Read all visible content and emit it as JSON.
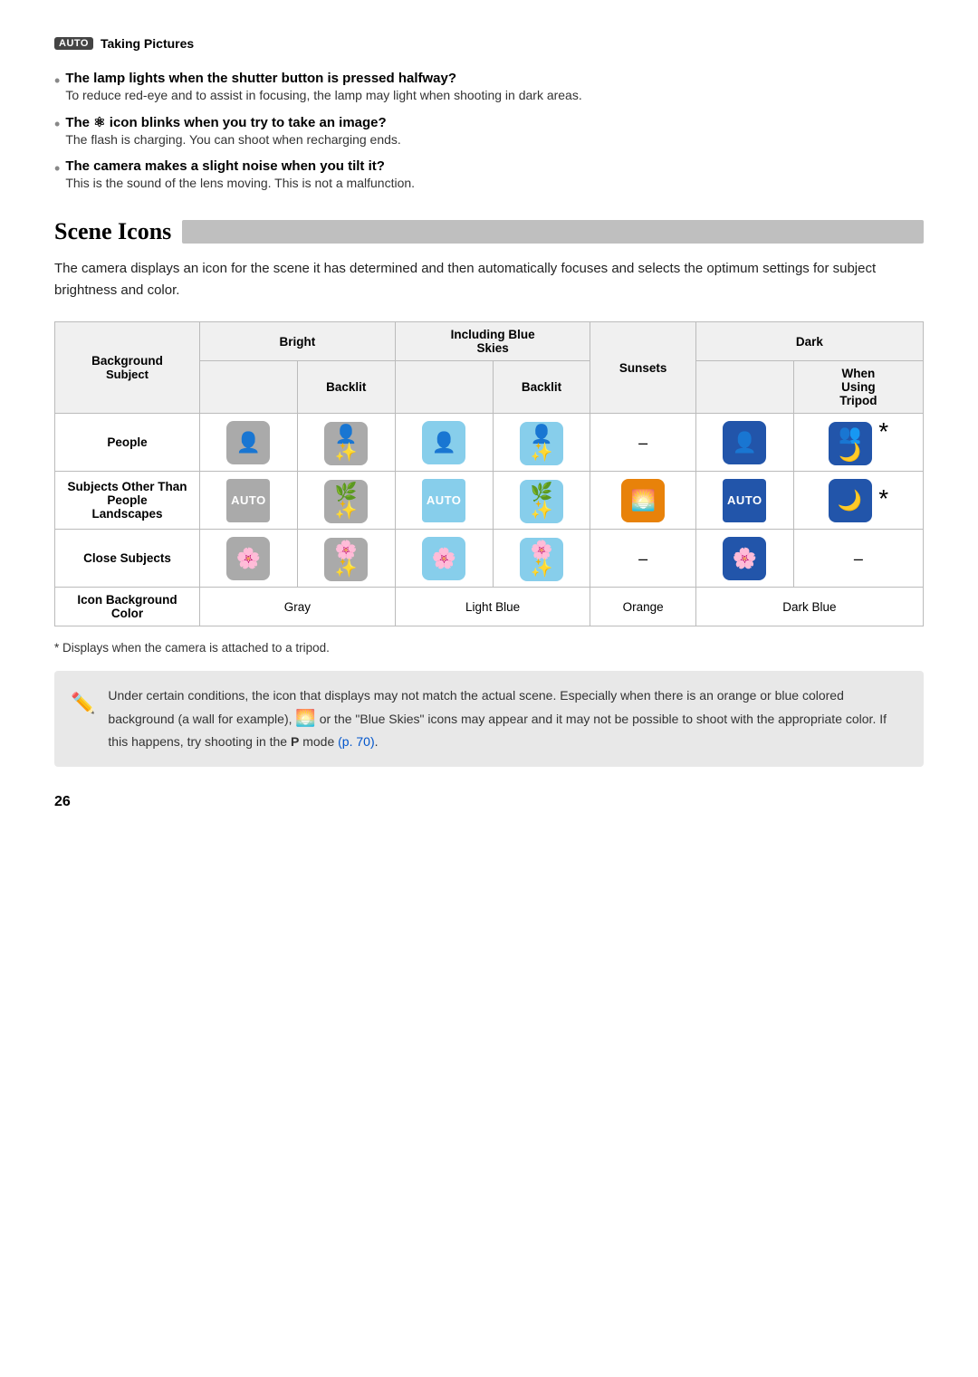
{
  "header": {
    "badge": "AUTO",
    "title": "Taking Pictures"
  },
  "faq": {
    "items": [
      {
        "question": "The lamp lights when the shutter button is pressed halfway?",
        "answer": "To reduce red-eye and to assist in focusing, the lamp may light when shooting in dark areas."
      },
      {
        "question": "The ↯ icon blinks when you try to take an image?",
        "answer": "The flash is charging. You can shoot when recharging ends."
      },
      {
        "question": "The camera makes a slight noise when you tilt it?",
        "answer": "This is the sound of the lens moving. This is not a malfunction."
      }
    ]
  },
  "section": {
    "title": "Scene Icons",
    "description": "The camera displays an icon for the scene it has determined and then automatically focuses and selects the optimum settings for subject brightness and color."
  },
  "table": {
    "col_headers": {
      "background": "Background",
      "subject": "Subject",
      "bright": "Bright",
      "backlit_bright": "Backlit",
      "including_blue_skies": "Including Blue\nSkies",
      "backlit_blue": "Backlit",
      "sunsets": "Sunsets",
      "dark": "Dark",
      "when_using_tripod": "When\nUsing\nTripod"
    },
    "rows": [
      {
        "label": "People",
        "icons": [
          "👤",
          "👤🔅",
          "👤",
          "👤🔅",
          "–",
          "👤",
          "👤🌙*"
        ]
      },
      {
        "label": "Subjects Other Than People\nLandscapes",
        "icons": [
          "AUTO",
          "🌿🔅",
          "AUTO",
          "🌿🔅",
          "🌅",
          "AUTO",
          "🌙*"
        ]
      },
      {
        "label": "Close Subjects",
        "icons": [
          "🌸",
          "🌸🔅",
          "🌸",
          "🌸🔅",
          "–",
          "🌸",
          "–"
        ]
      },
      {
        "label": "Icon Background\nColor",
        "icons": [
          "Gray",
          "Gray",
          "Light Blue",
          "Light Blue",
          "Orange",
          "Dark Blue",
          "Dark Blue"
        ]
      }
    ]
  },
  "footnote": "*  Displays when the camera is attached to a tripod.",
  "note": {
    "text": "Under certain conditions, the icon that displays may not match the actual scene. Especially when there is an orange or blue colored background (a wall for example),  or the \"Blue Skies\" icons may appear and it may not be possible to shoot with the appropriate color. If this happens, try shooting in the ",
    "bold_p": "P",
    "mode_text": " mode ",
    "link_text": "(p. 70)",
    "link_href": "#"
  },
  "page_number": "26"
}
